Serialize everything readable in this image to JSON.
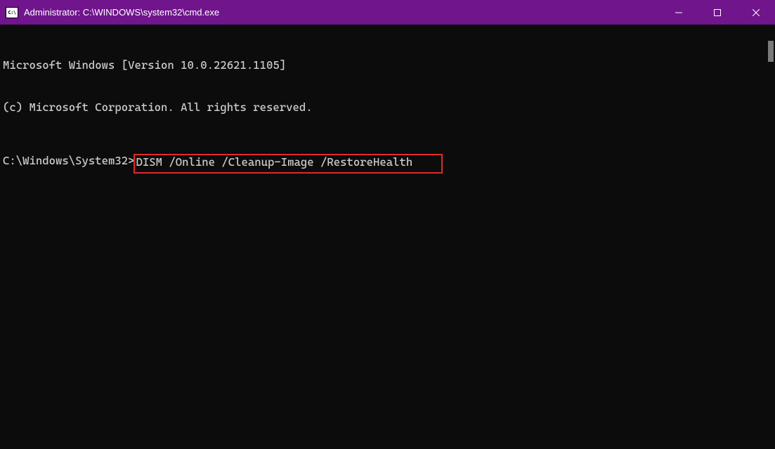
{
  "window": {
    "title": "Administrator: C:\\WINDOWS\\system32\\cmd.exe"
  },
  "terminal": {
    "line1": "Microsoft Windows [Version 10.0.22621.1105]",
    "line2": "(c) Microsoft Corporation. All rights reserved.",
    "prompt": "C:\\Windows\\System32>",
    "command": "DISM /Online /Cleanup-Image /RestoreHealth"
  }
}
